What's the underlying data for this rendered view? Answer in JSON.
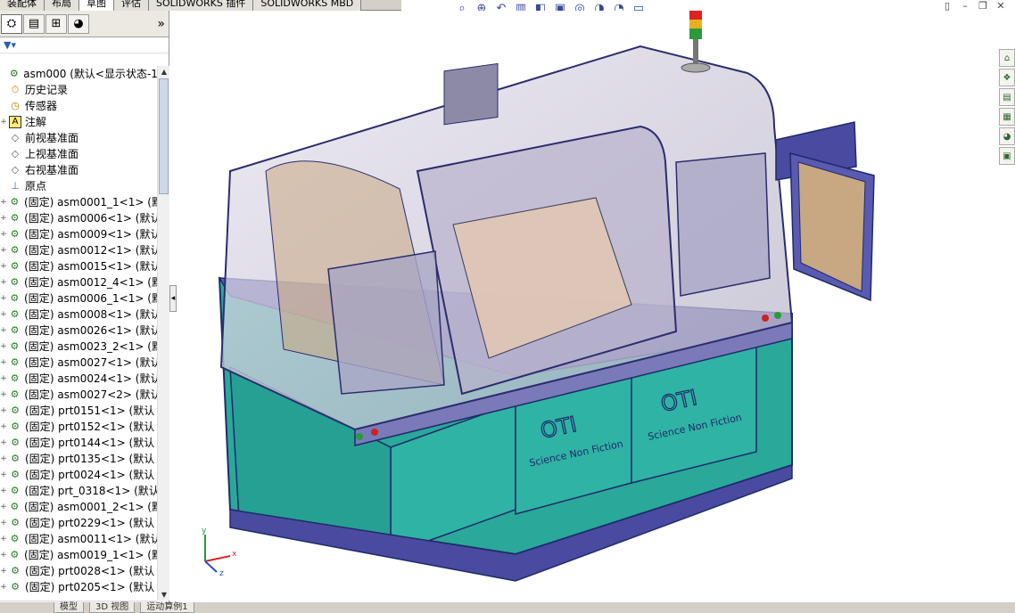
{
  "tabs": [
    "装配体",
    "布局",
    "草图",
    "评估",
    "SOLIDWORKS 插件",
    "SOLIDWORKS MBD"
  ],
  "active_tab_index": 2,
  "heads_up_icons": [
    "zoom-to-fit-icon",
    "zoom-area-icon",
    "previous-view-icon",
    "section-view-icon",
    "view-orientation-icon",
    "display-style-icon",
    "hide-show-icon",
    "appearance-icon",
    "scene-icon",
    "view-settings-icon"
  ],
  "window_controls": [
    "tile-icon",
    "minimize-icon",
    "restore-icon",
    "close-icon"
  ],
  "feature_manager": {
    "tool_icons": [
      "feature-manager-icon",
      "property-manager-icon",
      "configuration-manager-icon",
      "display-manager-icon"
    ],
    "more_label": "»",
    "filter_icon": "filter-icon",
    "tree": [
      {
        "label": "asm000  (默认<显示状态-1>",
        "icon": "assembly-icon",
        "expander": ""
      },
      {
        "label": "历史记录",
        "icon": "history-icon",
        "expander": ""
      },
      {
        "label": "传感器",
        "icon": "sensor-icon",
        "expander": ""
      },
      {
        "label": "注解",
        "icon": "annotation-icon",
        "expander": "+"
      },
      {
        "label": "前视基准面",
        "icon": "plane-icon",
        "expander": ""
      },
      {
        "label": "上视基准面",
        "icon": "plane-icon",
        "expander": ""
      },
      {
        "label": "右视基准面",
        "icon": "plane-icon",
        "expander": ""
      },
      {
        "label": "原点",
        "icon": "origin-icon",
        "expander": ""
      },
      {
        "label": "(固定) asm0001_1<1> (默",
        "icon": "assembly-icon",
        "expander": "+"
      },
      {
        "label": "(固定) asm0006<1> (默认",
        "icon": "assembly-icon",
        "expander": "+"
      },
      {
        "label": "(固定) asm0009<1> (默认",
        "icon": "assembly-icon",
        "expander": "+"
      },
      {
        "label": "(固定) asm0012<1> (默认",
        "icon": "assembly-icon",
        "expander": "+"
      },
      {
        "label": "(固定) asm0015<1> (默认",
        "icon": "assembly-icon",
        "expander": "+"
      },
      {
        "label": "(固定) asm0012_4<1> (默",
        "icon": "assembly-icon",
        "expander": "+"
      },
      {
        "label": "(固定) asm0006_1<1> (默",
        "icon": "assembly-icon",
        "expander": "+"
      },
      {
        "label": "(固定) asm0008<1> (默认",
        "icon": "assembly-icon",
        "expander": "+"
      },
      {
        "label": "(固定) asm0026<1> (默认",
        "icon": "assembly-icon",
        "expander": "+"
      },
      {
        "label": "(固定) asm0023_2<1> (默",
        "icon": "assembly-icon",
        "expander": "+"
      },
      {
        "label": "(固定) asm0027<1> (默认",
        "icon": "assembly-icon",
        "expander": "+"
      },
      {
        "label": "(固定) asm0024<1> (默认",
        "icon": "assembly-icon",
        "expander": "+"
      },
      {
        "label": "(固定) asm0027<2> (默认",
        "icon": "assembly-icon",
        "expander": "+"
      },
      {
        "label": "(固定) prt0151<1> (默认",
        "icon": "assembly-icon",
        "expander": "+"
      },
      {
        "label": "(固定) prt0152<1> (默认",
        "icon": "assembly-icon",
        "expander": "+"
      },
      {
        "label": "(固定) prt0144<1> (默认",
        "icon": "assembly-icon",
        "expander": "+"
      },
      {
        "label": "(固定) prt0135<1> (默认",
        "icon": "assembly-icon",
        "expander": "+"
      },
      {
        "label": "(固定) prt0024<1> (默认",
        "icon": "assembly-icon",
        "expander": "+"
      },
      {
        "label": "(固定) prt_0318<1> (默认",
        "icon": "assembly-icon",
        "expander": "+"
      },
      {
        "label": "(固定) asm0001_2<1> (默",
        "icon": "assembly-icon",
        "expander": "+"
      },
      {
        "label": "(固定) prt0229<1> (默认",
        "icon": "assembly-icon",
        "expander": "+"
      },
      {
        "label": "(固定) asm0011<1> (默认",
        "icon": "assembly-icon",
        "expander": "+"
      },
      {
        "label": "(固定) asm0019_1<1> (默",
        "icon": "assembly-icon",
        "expander": "+"
      },
      {
        "label": "(固定) prt0028<1> (默认",
        "icon": "assembly-icon",
        "expander": "+"
      },
      {
        "label": "(固定) prt0205<1> (默认",
        "icon": "assembly-icon",
        "expander": "+"
      }
    ]
  },
  "bottom_tabs": [
    "模型",
    "3D 视图",
    "运动算例1"
  ],
  "task_pane_icons": [
    "home-icon",
    "design-library-icon",
    "file-explorer-icon",
    "view-palette-icon",
    "appearances-icon",
    "custom-properties-icon"
  ],
  "model": {
    "brand_text": "OTI",
    "slogan_text": "Science Non Fiction",
    "colors": {
      "cabinet": "#2aa89a",
      "frame": "#4a4aa0",
      "glass": "#c9c6d6",
      "panel": "#c8a882"
    }
  },
  "triad": {
    "x_label": "x",
    "y_label": "y",
    "z_label": "z"
  }
}
